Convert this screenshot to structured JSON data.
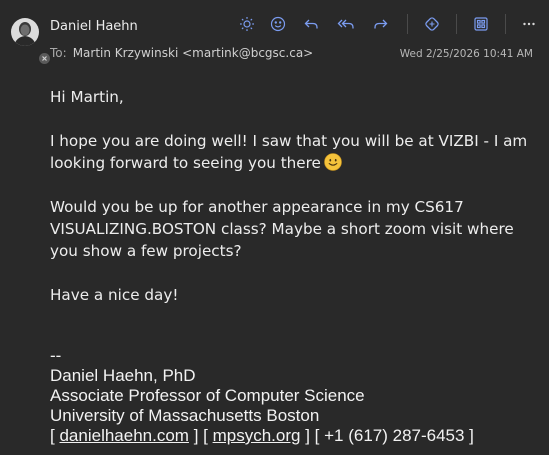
{
  "header": {
    "sender_name": "Daniel Haehn",
    "to_label": "To:",
    "to_value": "Martin Krzywinski <martink@bcgsc.ca>",
    "date": "Wed 2/25/2026 10:41 AM"
  },
  "toolbar": {
    "icons": [
      "sun-icon",
      "emoji-icon",
      "reply-icon",
      "reply-all-icon",
      "forward-icon",
      "loop-icon",
      "apps-icon",
      "more-icon"
    ]
  },
  "body": {
    "greeting": "Hi Martin,",
    "p1_line1": "I hope you are doing well! I saw that you will be at VIZBI - I am",
    "p1_line2": "looking forward to seeing you there",
    "p2_line1": "Would you be up for another appearance in my CS617",
    "p2_line2": "VISUALIZING.BOSTON class? Maybe a short zoom visit where",
    "p2_line3": "you show a few projects?",
    "closing": "Have a nice day!"
  },
  "signature": {
    "dashes": "--",
    "name": "Daniel Haehn, PhD",
    "title": "Associate Professor of Computer Science",
    "org": "University of Massachusetts Boston",
    "open_bracket": "[",
    "link1": "danielhaehn.com",
    "mid1": "] [",
    "link2": "mpsych.org",
    "mid2": "] [ +1 (617) 287-6453 ]"
  },
  "colors": {
    "background": "#292929",
    "accent": "#7b9cf0",
    "text": "#ededed"
  }
}
